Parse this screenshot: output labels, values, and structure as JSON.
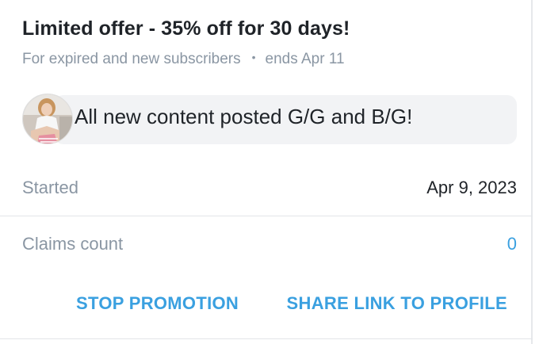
{
  "promotion": {
    "title": "Limited offer - 35% off for 30 days!",
    "audience": "For expired and new subscribers",
    "separator": "•",
    "ends": "ends Apr 11",
    "message": "All new content posted G/G and B/G!"
  },
  "details": {
    "started_label": "Started",
    "started_value": "Apr 9, 2023",
    "claims_label": "Claims count",
    "claims_value": "0"
  },
  "actions": {
    "stop_label": "STOP PROMOTION",
    "share_label": "SHARE LINK TO PROFILE"
  },
  "colors": {
    "accent": "#3aa0e0",
    "muted_text": "#8a96a3",
    "primary_text": "#1f2328",
    "bubble_bg": "#f2f3f5"
  }
}
